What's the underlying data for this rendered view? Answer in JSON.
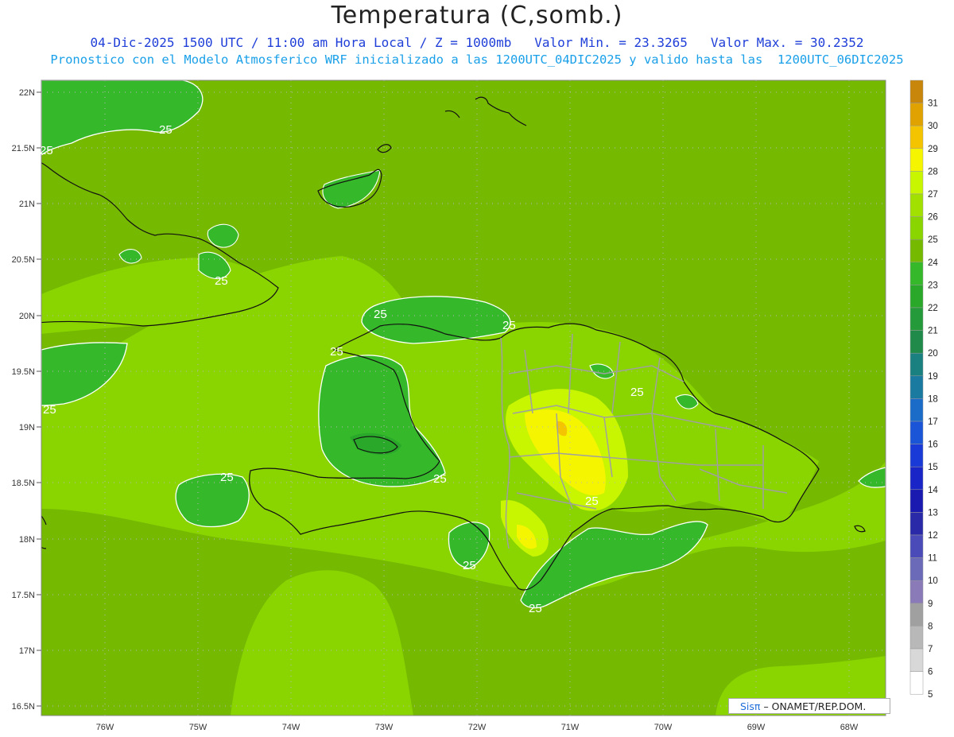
{
  "title": "Temperatura (C,somb.)",
  "subtitle_line1": {
    "date_time": "04-Dic-2025 1500 UTC / 11:00 am Hora Local / Z = 1000mb",
    "min": "Valor Min. = 23.3265",
    "max": "Valor Max. = 30.2352"
  },
  "subtitle_line2": "Pronostico con el Modelo Atmosferico WRF inicializado a las 1200UTC_04DIC2025 y valido hasta las  1200UTC_06DIC2025",
  "lat_labels": [
    "22N",
    "21.5N",
    "21N",
    "20.5N",
    "20N",
    "19.5N",
    "19N",
    "18.5N",
    "18N",
    "17.5N",
    "17N",
    "16.5N"
  ],
  "lon_labels": [
    "76W",
    "75W",
    "74W",
    "73W",
    "72W",
    "71W",
    "70W",
    "69W",
    "68W"
  ],
  "colorbar": {
    "levels": [
      "31",
      "30",
      "29",
      "28",
      "27",
      "26",
      "25",
      "24",
      "23",
      "22",
      "21",
      "20",
      "19",
      "18",
      "17",
      "16",
      "15",
      "14",
      "13",
      "12",
      "11",
      "10",
      "9",
      "8",
      "7",
      "6",
      "5"
    ],
    "colors": [
      "#c8860a",
      "#e0a200",
      "#f5c400",
      "#f5f500",
      "#c8f500",
      "#a2e000",
      "#8ad400",
      "#75b900",
      "#35b82a",
      "#2aa82a",
      "#259a3a",
      "#1f8a4a",
      "#1a8080",
      "#1a7aa0",
      "#1a6cc8",
      "#1a55d8",
      "#1a3ad8",
      "#1a25c8",
      "#1a1ab0",
      "#2a2aa8",
      "#4a4ab8",
      "#6a6ab8",
      "#8a7ab8",
      "#a0a0a0",
      "#b8b8b8",
      "#d8d8d8",
      "#ffffff"
    ]
  },
  "contour_labels": [
    "25",
    "25",
    "25",
    "25",
    "25",
    "25",
    "25",
    "25",
    "25",
    "25",
    "25",
    "25",
    "25",
    "25"
  ],
  "credit": {
    "sis": "Sisπ",
    "org": "– ONAMET/REP.DOM."
  }
}
